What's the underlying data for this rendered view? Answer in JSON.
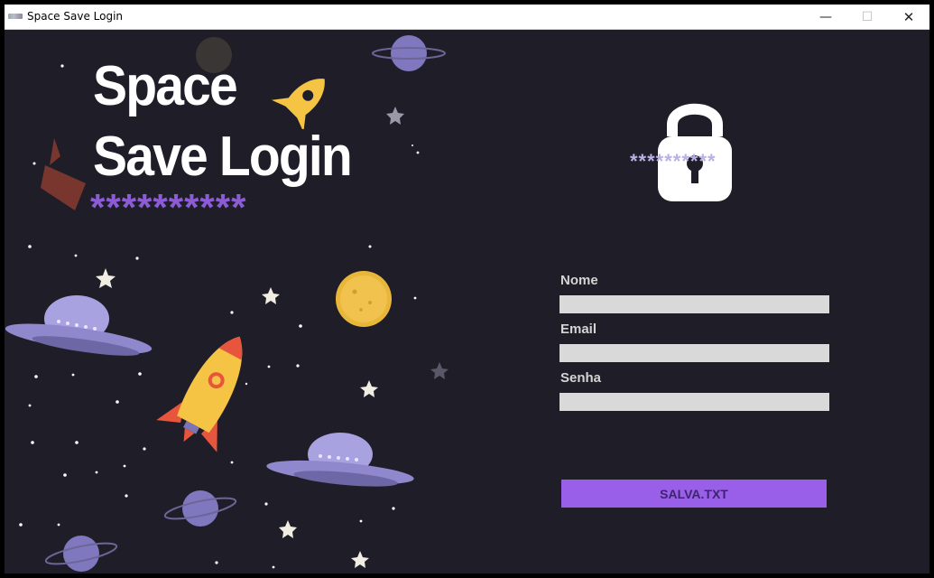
{
  "window": {
    "title": "Space Save Login",
    "controls": {
      "minimize": "—",
      "maximize": "☐",
      "close": "✕"
    }
  },
  "logo": {
    "line1": "Space",
    "line2": "Save Login",
    "mask": "**********",
    "icon": "rocket-icon"
  },
  "lock": {
    "icon": "padlock-icon",
    "mask": "**********"
  },
  "form": {
    "nome_label": "Nome",
    "nome_value": "",
    "email_label": "Email",
    "email_value": "",
    "senha_label": "Senha",
    "senha_value": "",
    "save_label": "SALVA.TXT"
  },
  "colors": {
    "background": "#1f1e28",
    "accent": "#9a5fe8",
    "logo_stars": "#8b5cd6",
    "input_bg": "#d9d9d9",
    "label": "#d4d4d4",
    "planet": "#8a82c9",
    "rocket_yellow": "#f6c445",
    "rocket_red": "#e8553d"
  }
}
